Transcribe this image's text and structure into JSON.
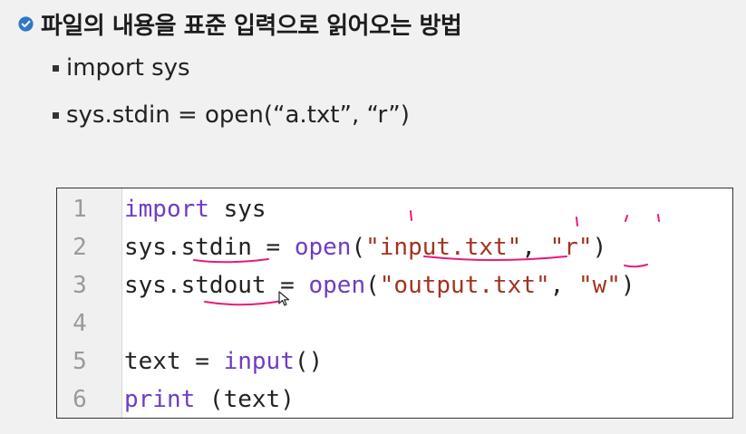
{
  "heading": {
    "text": "파일의 내용을 표준 입력으로 읽어오는 방법"
  },
  "bullets": [
    "import sys",
    "sys.stdin = open(“a.txt”, “r”)"
  ],
  "code": {
    "lines": [
      {
        "num": "1",
        "tokens": [
          {
            "t": "import",
            "c": "kw"
          },
          {
            "t": " sys",
            "c": "plain"
          }
        ]
      },
      {
        "num": "2",
        "tokens": [
          {
            "t": "sys.stdin = ",
            "c": "plain"
          },
          {
            "t": "open",
            "c": "kw"
          },
          {
            "t": "(",
            "c": "plain"
          },
          {
            "t": "\"input.txt\"",
            "c": "str"
          },
          {
            "t": ", ",
            "c": "plain"
          },
          {
            "t": "\"r\"",
            "c": "str"
          },
          {
            "t": ")",
            "c": "plain"
          }
        ]
      },
      {
        "num": "3",
        "tokens": [
          {
            "t": "sys.stdout = ",
            "c": "plain"
          },
          {
            "t": "open",
            "c": "kw"
          },
          {
            "t": "(",
            "c": "plain"
          },
          {
            "t": "\"output.txt\"",
            "c": "str"
          },
          {
            "t": ", ",
            "c": "plain"
          },
          {
            "t": "\"w\"",
            "c": "str"
          },
          {
            "t": ")",
            "c": "plain"
          }
        ]
      },
      {
        "num": "4",
        "tokens": []
      },
      {
        "num": "5",
        "tokens": [
          {
            "t": "text = ",
            "c": "plain"
          },
          {
            "t": "input",
            "c": "kw"
          },
          {
            "t": "()",
            "c": "plain"
          }
        ]
      },
      {
        "num": "6",
        "tokens": [
          {
            "t": "print",
            "c": "kw"
          },
          {
            "t": " (text)",
            "c": "plain"
          }
        ]
      }
    ]
  },
  "colors": {
    "keyword": "#6f3cc4",
    "string": "#a2331f",
    "annotation": "#e8197a",
    "check_icon": "#2f78c8"
  }
}
